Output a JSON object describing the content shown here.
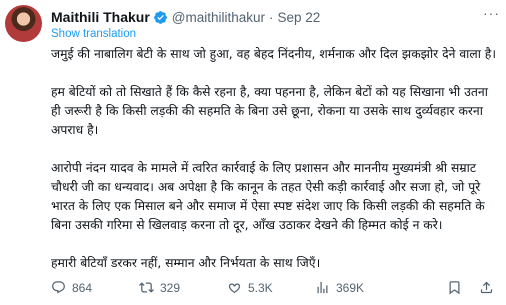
{
  "tweet": {
    "author_name": "Maithili Thakur",
    "handle": "@maithilithakur",
    "separator": "·",
    "date": "Sep 22",
    "more_label": "···",
    "translate_label": "Show translation",
    "paragraphs": [
      "जमुई की नाबालिग बेटी के साथ जो हुआ, वह बेहद निंदनीय, शर्मनाक और दिल झकझोर देने वाला है।",
      "हम बेटियों को तो सिखाते हैं कि कैसे रहना है, क्या पहनना है, लेकिन बेटों को यह सिखाना भी उतना ही जरूरी है कि किसी लड़की की सहमति के बिना उसे छूना, रोकना या उसके साथ दुर्व्यवहार करना अपराध है।",
      "आरोपी नंदन यादव के मामले में त्वरित कार्रवाई के लिए प्रशासन और माननीय मुख्यमंत्री श्री सम्राट चौधरी जी का धन्यवाद। अब अपेक्षा है कि कानून के तहत ऐसी कड़ी कार्रवाई और सजा हो, जो पूरे भारत के लिए एक मिसाल बने और समाज में ऐसा स्पष्ट संदेश जाए कि किसी लड़की की सहमति के बिना उसकी गरिमा से खिलवाड़ करना तो दूर, आँख उठाकर देखने की हिम्मत कोई न करे।",
      "हमारी बेटियाँ डरकर नहीं, सम्मान और निर्भयता के साथ जिएँ।"
    ],
    "stats": {
      "replies": "864",
      "reposts": "329",
      "likes": "5.3K",
      "views": "369K"
    }
  },
  "icons": {
    "verified": "verified-badge-icon",
    "reply": "reply-icon",
    "repost": "repost-icon",
    "like": "heart-icon",
    "views": "views-chart-icon",
    "bookmark": "bookmark-icon",
    "share": "share-icon"
  },
  "colors": {
    "accent": "#1d9bf0",
    "secondary_text": "#536471",
    "primary_text": "#0f1419"
  }
}
